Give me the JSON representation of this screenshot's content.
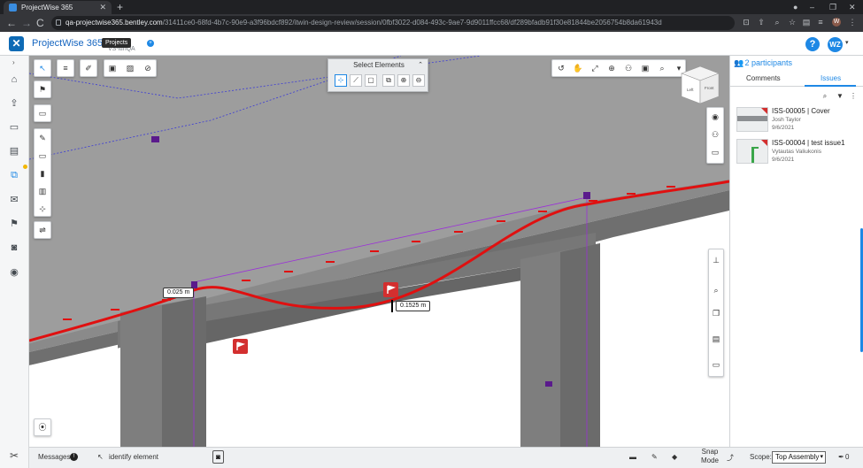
{
  "browser": {
    "tab_title": "ProjectWise 365",
    "tab_close": "✕",
    "new_tab": "+",
    "url_host": "qa-projectwise365.bentley.com",
    "url_path": "/31411ce0-68fd-4b7c-90e9-a3f96bdcf892/itwin-design-review/session/0fbf3022-d084-493c-9ae7-9d9011ffcc68/df289bfadb91f30e81844be2056754b8da61943d",
    "nav_back": "←",
    "nav_forward": "→",
    "nav_reload": "C",
    "window_minimize": "–",
    "window_maximize": "❐",
    "window_close": "✕"
  },
  "app": {
    "name": "ProjectWise 365",
    "logo_glyph": "✕",
    "tooltip": "Projects",
    "project_name": "VS-itinQA",
    "project_badge": "+",
    "help": "?",
    "avatar_initials": "WZ",
    "avatar_caret": "▾"
  },
  "sidebar": {
    "expand": "›",
    "items": [
      {
        "icon": "home-icon",
        "glyph": "⌂"
      },
      {
        "icon": "upload-icon",
        "glyph": "⇪"
      },
      {
        "icon": "monitor-icon",
        "glyph": "▭"
      },
      {
        "icon": "documents-icon",
        "glyph": "▤"
      },
      {
        "icon": "design-review-icon",
        "glyph": "⧉"
      },
      {
        "icon": "approval-icon",
        "glyph": "✉"
      },
      {
        "icon": "flag-icon",
        "glyph": "⚑"
      },
      {
        "icon": "camera-icon",
        "glyph": "◙"
      },
      {
        "icon": "eye-icon",
        "glyph": "◉"
      }
    ],
    "settings_glyph": "✂"
  },
  "select_panel": {
    "title": "Select Elements",
    "collapse": "⌃"
  },
  "measurements": {
    "first": "0.025 m",
    "second": "0.1525 m"
  },
  "navcube": {
    "left_face": "Left",
    "front_face": "Front"
  },
  "right_panel": {
    "participants": "2 participants",
    "participants_glyph": "👥",
    "tabs": [
      "Comments",
      "Issues"
    ],
    "active_tab": "Issues",
    "tools": {
      "search": "⌕",
      "filter": "▼",
      "more": "⋮"
    },
    "issues": [
      {
        "title": "ISS-00005 | Cover",
        "author": "Josh Taylor",
        "date": "9/6/2021"
      },
      {
        "title": "ISS-00004 | test issue1",
        "author": "Vytautas Valiukonis",
        "date": "9/6/2021"
      }
    ]
  },
  "status_bar": {
    "messages": "Messages",
    "messages_badge": "!",
    "cursor_glyph": "↖",
    "prompt": "identify element",
    "snap_mode": "Snap Mode",
    "scope_label": "Scope:",
    "scope_value": "Top Assembly",
    "scope_caret": "▾",
    "count": "0",
    "pin_glyph": "✎"
  },
  "colors": {
    "accent": "#1e88e5",
    "issue_red": "#d32f2f",
    "rail_red": "#e01010",
    "marker_purple": "#5a1a8c",
    "deck_gray": "#8d8d8d"
  }
}
